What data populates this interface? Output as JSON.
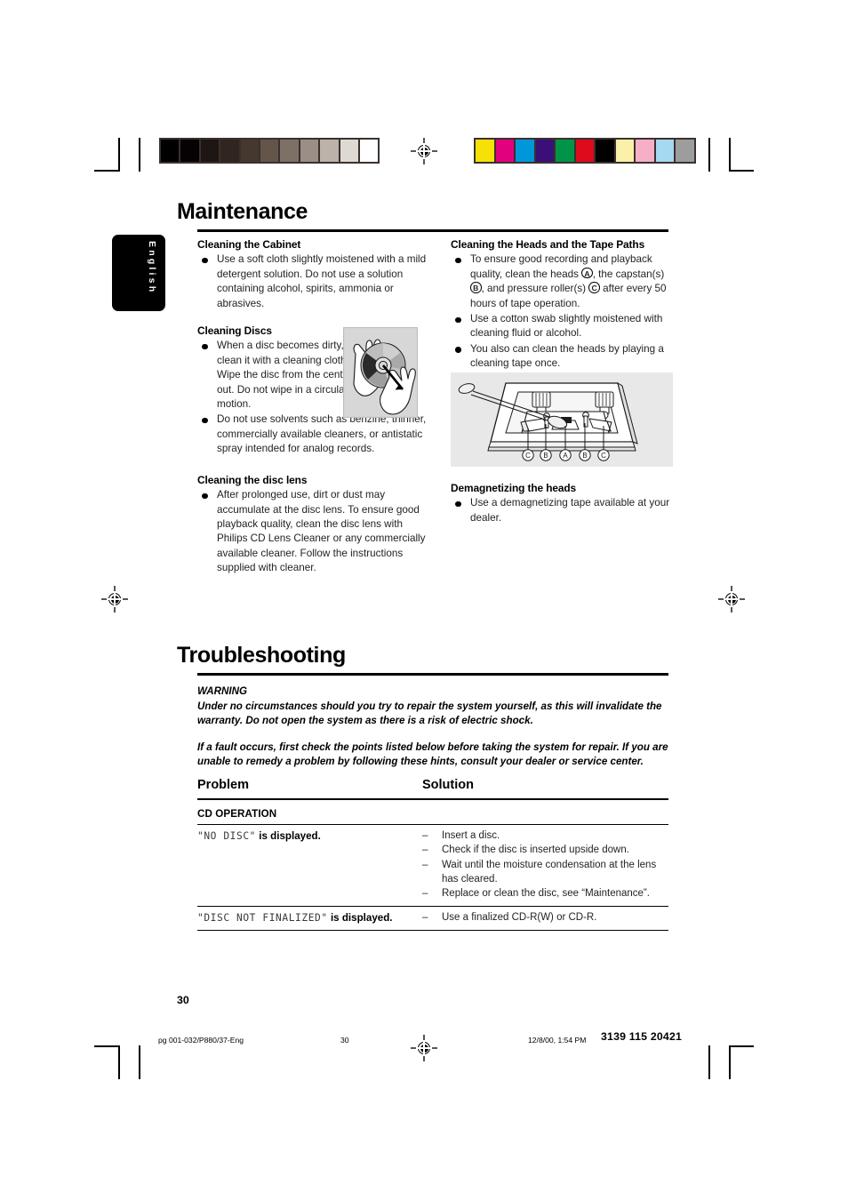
{
  "page": {
    "language_tab": "English",
    "page_number": "30"
  },
  "prepress": {
    "grayscale_swatches": [
      "#000000",
      "#060203",
      "#1e1614",
      "#30251f",
      "#45382f",
      "#635549",
      "#7d7067",
      "#9a8e86",
      "#bdb2a9",
      "#ded9d2",
      "#ffffff"
    ],
    "color_swatches": [
      "#f7e007",
      "#e3007f",
      "#0096da",
      "#3a1078",
      "#009446",
      "#dd0b1c",
      "#000000",
      "#faf0a8",
      "#f6afc7",
      "#a5d8f3",
      "#9d9d9d"
    ]
  },
  "maintenance": {
    "title": "Maintenance",
    "left_column": [
      {
        "heading": "Cleaning the Cabinet",
        "bullets": [
          "Use a soft cloth slightly moistened with a mild detergent solution. Do not use a solution containing alcohol, spirits, ammonia or abrasives."
        ]
      },
      {
        "heading": "Cleaning Discs",
        "bullets": [
          "When a disc becomes dirty, clean it with a cleaning cloth. Wipe the disc from the center out.  Do not wipe in a circular motion.",
          "Do not use solvents such as benzine, thinner, commercially available cleaners, or antistatic spray intended for analog records."
        ]
      },
      {
        "heading": "Cleaning the disc lens",
        "bullets": [
          "After prolonged use, dirt or dust may accumulate at the disc lens. To ensure good playback quality, clean the disc lens with Philips CD Lens Cleaner or any commercially available cleaner. Follow the instructions supplied with cleaner."
        ]
      }
    ],
    "right_column": [
      {
        "heading": "Cleaning the Heads and the Tape Paths",
        "bullets_rich": [
          {
            "parts": [
              {
                "t": "text",
                "v": "To ensure good recording and playback quality, clean the heads "
              },
              {
                "t": "circle",
                "v": "A"
              },
              {
                "t": "text",
                "v": ", the capstan(s) "
              },
              {
                "t": "circle",
                "v": "B"
              },
              {
                "t": "text",
                "v": ", and pressure roller(s) "
              },
              {
                "t": "circle",
                "v": "C"
              },
              {
                "t": "text",
                "v": " after every 50 hours of tape operation."
              }
            ]
          }
        ],
        "bullets": [
          "Use a cotton swab slightly moistened with cleaning fluid or alcohol.",
          "You also can clean the heads by playing a cleaning tape once."
        ]
      },
      {
        "heading": "Demagnetizing the heads",
        "bullets": [
          "Use a demagnetizing tape available at your dealer."
        ]
      }
    ],
    "figures": {
      "disc_cleaning": {
        "name": "disc-cleaning-illustration",
        "description": "Hands wiping a disc from the center outward"
      },
      "tape_deck": {
        "name": "tape-deck-heads-illustration",
        "description": "Cassette mechanism with cotton swab cleaning the heads",
        "callouts": [
          "C",
          "B",
          "A",
          "B",
          "C"
        ]
      }
    }
  },
  "troubleshooting": {
    "title": "Troubleshooting",
    "warning_label": "WARNING",
    "warning_paragraphs": [
      "Under no circumstances should you try to repair the system yourself, as this will invalidate the warranty.  Do not open the system as there is a risk of electric shock.",
      "If a fault occurs, first check the points listed below before taking the system for repair. If you are unable to remedy a problem by following these hints, consult your dealer or service center."
    ],
    "table": {
      "headers": {
        "problem": "Problem",
        "solution": "Solution"
      },
      "groups": [
        {
          "group_label": "CD OPERATION",
          "rows": [
            {
              "problem_display": "\"NO DISC\"",
              "problem_suffix": "is displayed.",
              "solutions": [
                "Insert a disc.",
                "Check if the disc is inserted upside down.",
                "Wait until the moisture condensation at the lens has cleared.",
                "Replace or clean the disc, see “Maintenance”."
              ]
            },
            {
              "problem_display": "\"DISC NOT FINALIZED\"",
              "problem_suffix": "is displayed.",
              "solutions": [
                "Use a finalized CD-R(W) or CD-R."
              ]
            }
          ]
        }
      ]
    }
  },
  "footer": {
    "file_reference": "pg 001-032/P880/37-Eng",
    "page_number": "30",
    "timestamp": "12/8/00, 1:54 PM",
    "document_code": "3139 115 20421"
  }
}
